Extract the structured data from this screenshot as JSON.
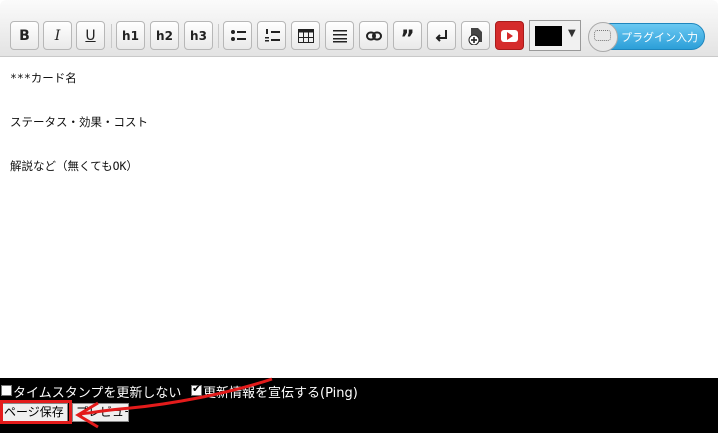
{
  "toolbar": {
    "buttons": [
      {
        "name": "bold-button",
        "label": "B"
      },
      {
        "name": "italic-button",
        "label": "I"
      },
      {
        "name": "underline-button",
        "label": "U"
      },
      {
        "name": "heading1-button",
        "label": "h1"
      },
      {
        "name": "heading2-button",
        "label": "h2"
      },
      {
        "name": "heading3-button",
        "label": "h3"
      }
    ],
    "plugin_label": "プラグイン入力",
    "text_color": "#000000"
  },
  "editor": {
    "lines": [
      "***カード名",
      "ステータス・効果・コスト",
      "解説など（無くてもOK）"
    ]
  },
  "options": {
    "timestamp_label": "タイムスタンプを更新しない",
    "timestamp_checked": false,
    "ping_label": "更新情報を宣伝する(Ping)",
    "ping_checked": true
  },
  "actions": {
    "save_label": "ページ保存",
    "preview_label": "プレビュー"
  },
  "annotation_color": "#e31b1b"
}
